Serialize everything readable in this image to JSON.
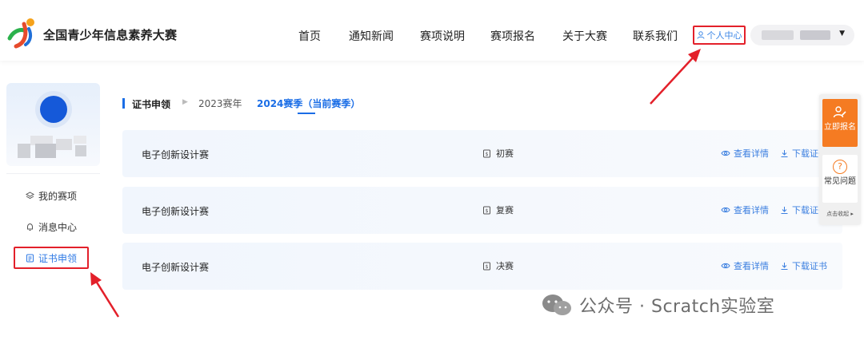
{
  "header": {
    "site_title": "全国青少年信息素养大赛",
    "nav": [
      "首页",
      "通知新闻",
      "赛项说明",
      "赛项报名",
      "关于大赛",
      "联系我们"
    ],
    "personal_center": "个人中心"
  },
  "sidebar": {
    "items": [
      {
        "label": "我的赛项"
      },
      {
        "label": "消息中心"
      },
      {
        "label": "证书申领"
      }
    ]
  },
  "main": {
    "breadcrumb_title": "证书申领",
    "tabs": [
      {
        "label": "2023赛年"
      },
      {
        "label": "2024赛季（当前赛季）"
      }
    ],
    "rows": [
      {
        "name": "电子创新设计赛",
        "stage": "初赛",
        "view_label": "查看详情",
        "download_label": "下载证书"
      },
      {
        "name": "电子创新设计赛",
        "stage": "复赛",
        "view_label": "查看详情",
        "download_label": "下载证书"
      },
      {
        "name": "电子创新设计赛",
        "stage": "决赛",
        "view_label": "查看详情",
        "download_label": "下载证书"
      }
    ]
  },
  "float_panel": {
    "signup_label": "立即报名",
    "faq_label": "常见问题",
    "collapse_label": "点击收起"
  },
  "watermark": {
    "text": "公众号 · Scratch实验室"
  },
  "colors": {
    "accent_blue": "#1a6de6",
    "highlight_red": "#e3202a",
    "orange": "#f57b22"
  }
}
